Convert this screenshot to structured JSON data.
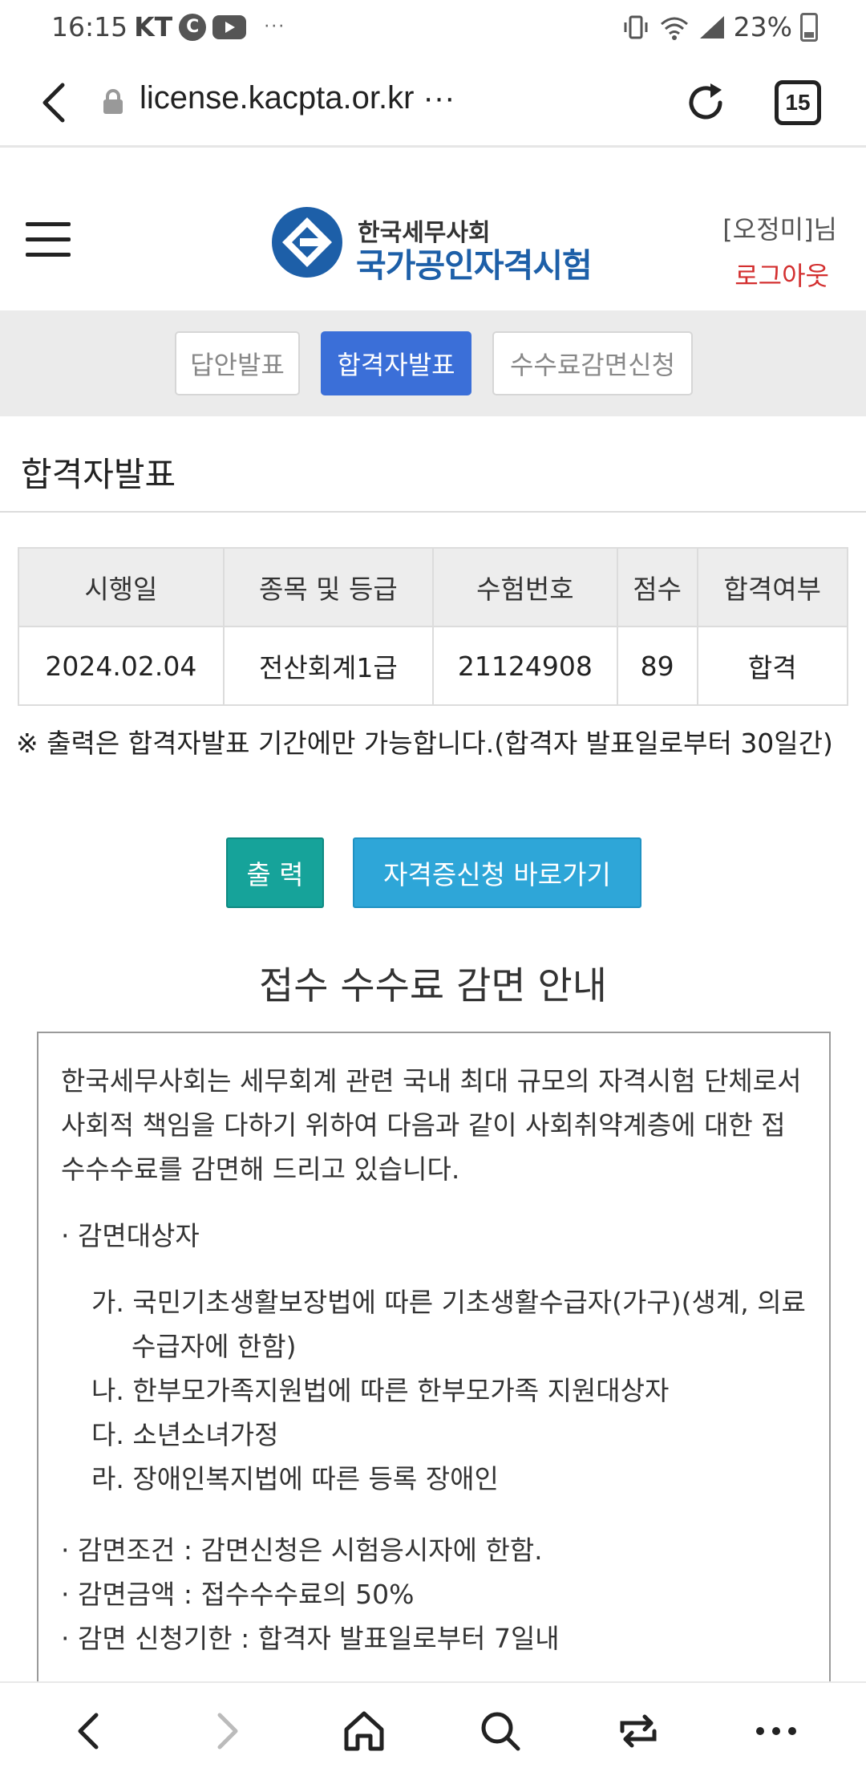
{
  "status_bar": {
    "time": "16:15",
    "carrier": "KT",
    "c_badge": "C",
    "more": "···",
    "battery": "23%",
    "icons": [
      "vibrate-icon",
      "wifi-icon",
      "signal-icon",
      "battery-icon"
    ]
  },
  "browser": {
    "url": "license.kacpta.or.kr ···",
    "tab_count": "15"
  },
  "header": {
    "logo_line1": "한국세무사회",
    "logo_line2": "국가공인자격시험",
    "user": "[오정미]님",
    "logout": "로그아웃"
  },
  "sub_tabs": [
    {
      "label": "답안발표",
      "active": false
    },
    {
      "label": "합격자발표",
      "active": true
    },
    {
      "label": "수수료감면신청",
      "active": false
    }
  ],
  "section_title": "합격자발표",
  "result_table": {
    "headers": [
      "시행일",
      "종목 및 등급",
      "수험번호",
      "점수",
      "합격여부"
    ],
    "rows": [
      [
        "2024.02.04",
        "전산회계1급",
        "21124908",
        "89",
        "합격"
      ]
    ]
  },
  "note": "※ 출력은 합격자발표 기간에만 가능합니다.(합격자 발표일로부터 30일간)",
  "buttons": {
    "print": "출 력",
    "certificate": "자격증신청 바로가기"
  },
  "fee_notice": {
    "title": "접수 수수료 감면 안내",
    "intro": "한국세무사회는 세무회계 관련 국내 최대 규모의 자격시험 단체로서 사회적 책임을 다하기 위하여 다음과 같이 사회취약계층에 대한 접수수수료를 감면해 드리고 있습니다.",
    "target_heading": "· 감면대상자",
    "targets": [
      "가. 국민기초생활보장법에 따른 기초생활수급자(가구)(생계, 의료 수급자에 한함)",
      "나. 한부모가족지원법에 따른 한부모가족 지원대상자",
      "다. 소년소녀가정",
      "라. 장애인복지법에 따른 등록 장애인"
    ],
    "condition": "· 감면조건 : 감면신청은 시험응시자에 한함.",
    "amount": "· 감면금액 : 접수수수료의 50%",
    "deadline": "· 감면 신청기한 : 합격자 발표일로부터 7일내"
  },
  "colors": {
    "active_tab": "#3b6fd8",
    "print_button": "#16a39a",
    "certificate_button": "#2ea6d8",
    "logout": "#d32f2f",
    "logo_blue": "#1d5fa8"
  }
}
